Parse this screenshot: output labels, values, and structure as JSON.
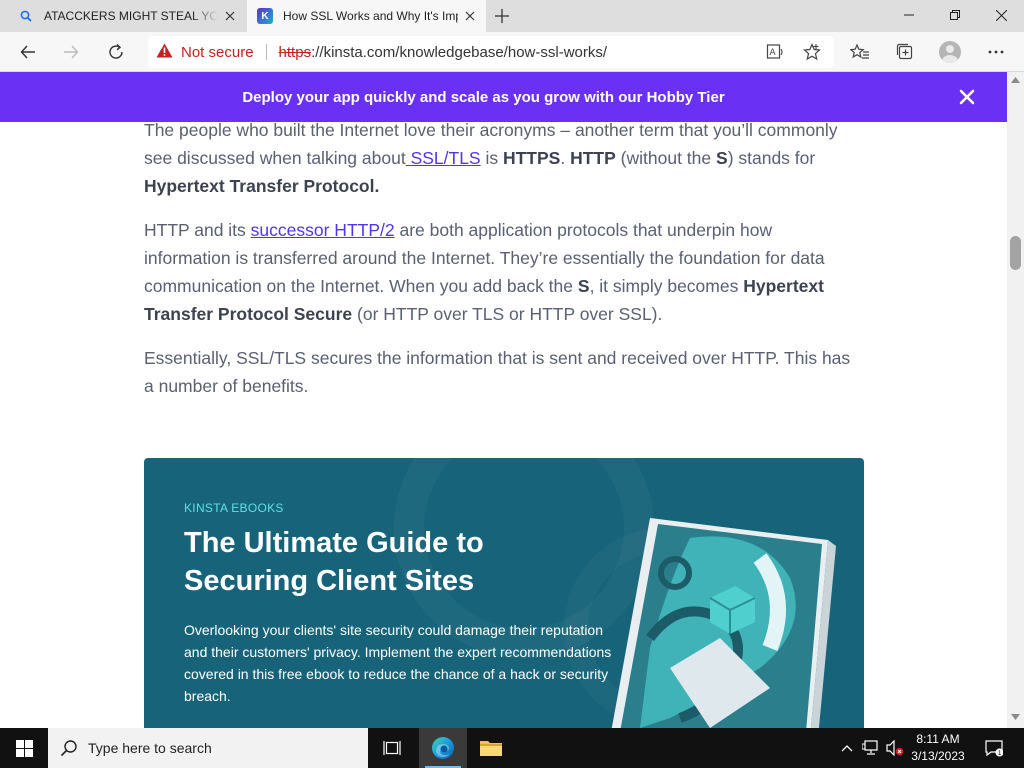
{
  "browser": {
    "tabs": [
      {
        "title": "ATACCKERS MIGHT STEAL YOUR INFORMATION",
        "active": false
      },
      {
        "title": "How SSL Works and Why It's Important",
        "active": true
      }
    ],
    "address": {
      "security_label": "Not secure",
      "protocol": "https",
      "url_rest": "://kinsta.com/knowledgebase/how-ssl-works/"
    }
  },
  "banner": {
    "text": "Deploy your app quickly and scale as you grow with our Hobby Tier"
  },
  "article": {
    "p1": {
      "t1": "The people who built the Internet love their acronyms – another term that you’ll commonly see discussed when talking about",
      "link": " SSL/TLS",
      "t2": " is ",
      "b1": "HTTPS",
      "t3": ". ",
      "b2": "HTTP",
      "t4": " (without the ",
      "b3": "S",
      "t5": ") stands for ",
      "b4": "Hypertext Transfer Protocol."
    },
    "p2": {
      "t1": "HTTP and its ",
      "link": "successor HTTP/2",
      "t2": " are both application protocols that underpin how information is transferred around the Internet. They’re essentially the foundation for data communication on the Internet. When you add back the ",
      "b1": "S",
      "t3": ", it simply becomes ",
      "b2": "Hypertext Transfer Protocol Secure",
      "t4": " (or HTTP over TLS or HTTP over SSL)."
    },
    "p3": {
      "text": "Essentially, SSL/TLS secures the information that is sent and received over HTTP. This has a number of benefits."
    }
  },
  "ebook": {
    "kicker": "KINSTA EBOOKS",
    "title": "The Ultimate Guide to Securing Client Sites",
    "description": "Overlooking your clients' site security could damage their reputation and their customers' privacy. Implement the expert recommendations covered in this free ebook to reduce the chance of a hack or security breach."
  },
  "taskbar": {
    "search_placeholder": "Type here to search",
    "time": "8:11 AM",
    "date": "3/13/2023"
  }
}
